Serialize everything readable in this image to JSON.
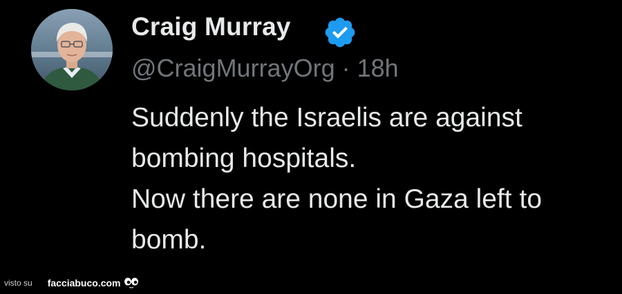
{
  "tweet": {
    "author_name": "Craig Murray",
    "author_handle": "@CraigMurrayOrg",
    "separator": "·",
    "time_ago": "18h",
    "verified": true,
    "verified_color": "#1d9bf0",
    "text_lines": [
      "Suddenly the Israelis are against",
      "bombing hospitals.",
      "Now there are none in Gaza left to",
      "bomb."
    ]
  },
  "watermark": {
    "prefix": "visto su",
    "brand": "facciabuco.com",
    "icon": "eyes-icon"
  },
  "colors": {
    "background": "#000000",
    "primary_text": "#e7e9ea",
    "secondary_text": "#71767b"
  }
}
